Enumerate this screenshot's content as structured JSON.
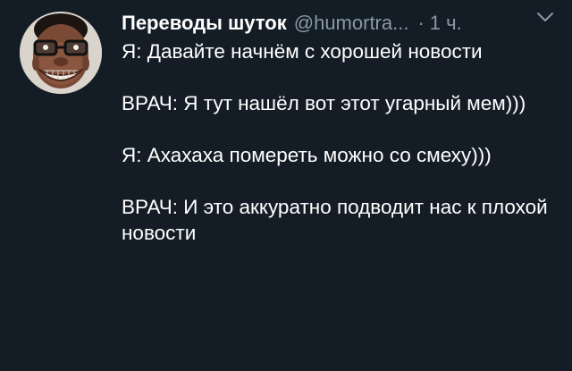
{
  "tweet": {
    "author_name": "Переводы шуток",
    "handle": "@humortra...",
    "separator": "·",
    "time": "1 ч.",
    "paragraphs": [
      "Я: Давайте начнём с хорошей новости",
      "ВРАЧ: Я тут нашёл вот этот угарный мем)))",
      "Я: Ахахаха помереть можно со смеху)))",
      "ВРАЧ: И это аккуратно подводит нас к плохой новости"
    ]
  },
  "icons": {
    "avatar": "avatar-photo",
    "menu": "chevron-down-icon"
  },
  "colors": {
    "background": "#141d26",
    "text": "#ffffff",
    "muted": "#8899a6"
  }
}
